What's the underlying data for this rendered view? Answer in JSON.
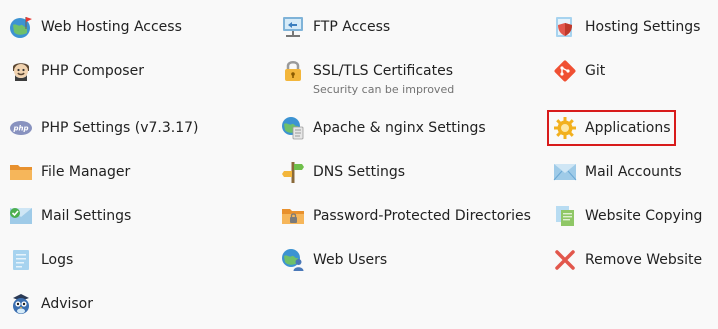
{
  "tools": {
    "web_hosting_access": {
      "label": "Web Hosting Access",
      "icon": "globe-flag-icon"
    },
    "ftp_access": {
      "label": "FTP Access",
      "icon": "ftp-computer-icon"
    },
    "hosting_settings": {
      "label": "Hosting Settings",
      "icon": "document-shield-icon"
    },
    "php_composer": {
      "label": "PHP Composer",
      "icon": "composer-musician-icon"
    },
    "ssl_tls": {
      "label": "SSL/TLS Certificates",
      "sublabel": "Security can be improved",
      "icon": "padlock-warning-icon"
    },
    "git": {
      "label": "Git",
      "icon": "git-icon"
    },
    "php_settings": {
      "label": "PHP Settings (v7.3.17)",
      "icon": "php-badge-icon"
    },
    "apache_nginx": {
      "label": "Apache & nginx Settings",
      "icon": "globe-document-icon"
    },
    "applications": {
      "label": "Applications",
      "icon": "gear-icon",
      "highlighted": true
    },
    "file_manager": {
      "label": "File Manager",
      "icon": "folder-icon"
    },
    "dns_settings": {
      "label": "DNS Settings",
      "icon": "signpost-icon"
    },
    "mail_accounts": {
      "label": "Mail Accounts",
      "icon": "envelope-icon"
    },
    "mail_settings": {
      "label": "Mail Settings",
      "icon": "envelope-check-icon"
    },
    "password_protected": {
      "label": "Password-Protected Directories",
      "icon": "locked-folder-icon"
    },
    "website_copying": {
      "label": "Website Copying",
      "icon": "copy-documents-icon"
    },
    "logs": {
      "label": "Logs",
      "icon": "log-document-icon"
    },
    "web_users": {
      "label": "Web Users",
      "icon": "globe-user-icon"
    },
    "remove_website": {
      "label": "Remove Website",
      "icon": "red-x-icon"
    },
    "advisor": {
      "label": "Advisor",
      "icon": "advisor-owl-icon"
    }
  },
  "colors": {
    "highlight_border": "#d81b1b",
    "label_text": "#222222",
    "sublabel_text": "#737373"
  }
}
